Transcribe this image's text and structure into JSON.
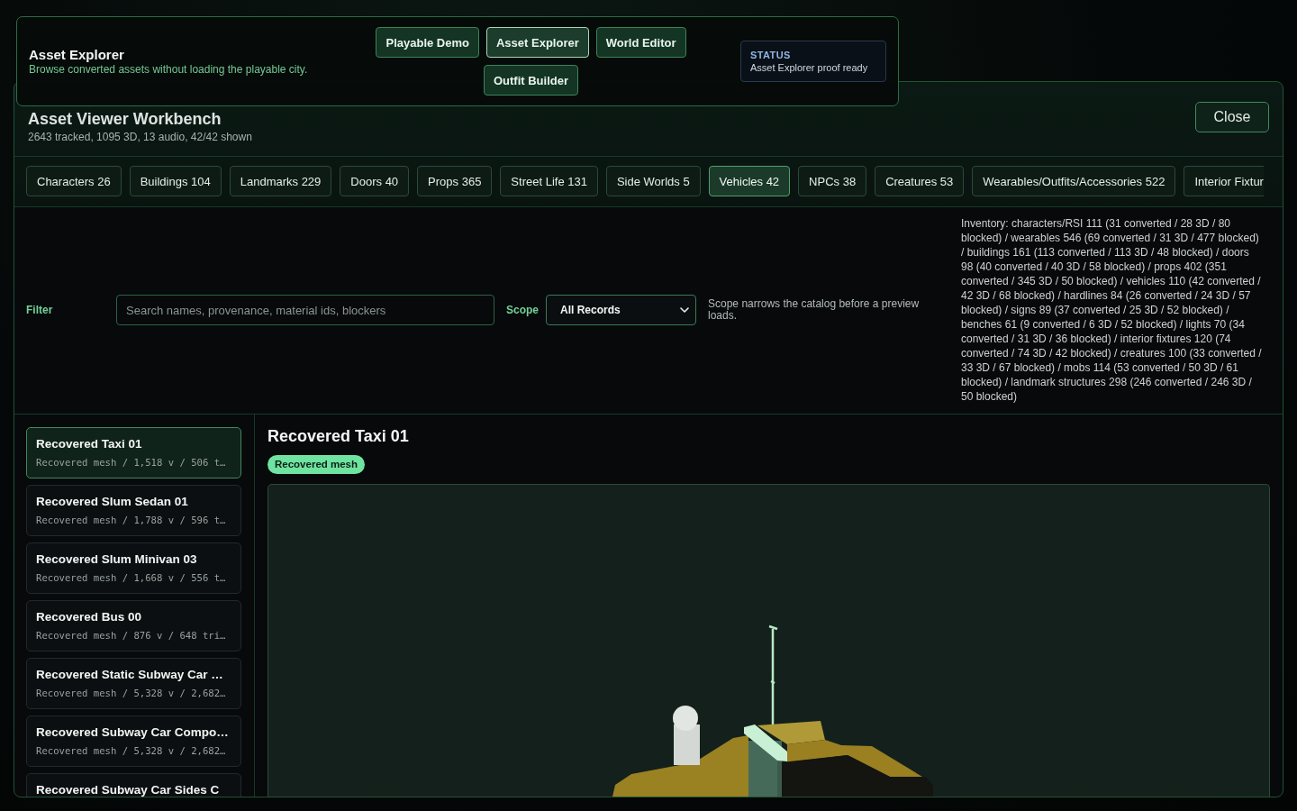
{
  "header": {
    "title": "Asset Explorer",
    "subtitle": "Browse converted assets without loading the playable city.",
    "nav": [
      {
        "label": "Playable Demo",
        "selected": false
      },
      {
        "label": "Asset Explorer",
        "selected": true
      },
      {
        "label": "World Editor",
        "selected": false
      },
      {
        "label": "Outfit Builder",
        "selected": false
      }
    ],
    "status": {
      "label": "STATUS",
      "text": "Asset Explorer proof ready"
    }
  },
  "workbench": {
    "title": "Asset Viewer Workbench",
    "summary": "2643 tracked, 1095 3D, 13 audio, 42/42 shown",
    "close_label": "Close"
  },
  "categories": [
    {
      "label": "Characters 26",
      "selected": false
    },
    {
      "label": "Buildings 104",
      "selected": false
    },
    {
      "label": "Landmarks 229",
      "selected": false
    },
    {
      "label": "Doors 40",
      "selected": false
    },
    {
      "label": "Props 365",
      "selected": false
    },
    {
      "label": "Street Life 131",
      "selected": false
    },
    {
      "label": "Side Worlds 5",
      "selected": false
    },
    {
      "label": "Vehicles 42",
      "selected": true
    },
    {
      "label": "NPCs 38",
      "selected": false
    },
    {
      "label": "Creatures 53",
      "selected": false
    },
    {
      "label": "Wearables/Outfits/Accessories 522",
      "selected": false
    },
    {
      "label": "Interior Fixtur",
      "selected": false
    }
  ],
  "filter": {
    "label": "Filter",
    "placeholder": "Search names, provenance, material ids, blockers",
    "scope_label": "Scope",
    "scope_value": "All Records",
    "scope_hint": "Scope narrows the catalog before a preview loads.",
    "inventory": "Inventory: characters/RSI 111 (31 converted / 28 3D / 80 blocked) / wearables 546 (69 converted / 31 3D / 477 blocked) / buildings 161 (113 converted / 113 3D / 48 blocked) / doors 98 (40 converted / 40 3D / 58 blocked) / props 402 (351 converted / 345 3D / 50 blocked) / vehicles 110 (42 converted / 42 3D / 68 blocked) / hardlines 84 (26 converted / 24 3D / 57 blocked) / signs 89 (37 converted / 25 3D / 52 blocked) / benches 61 (9 converted / 6 3D / 52 blocked) / lights 70 (34 converted / 31 3D / 36 blocked) / interior fixtures 120 (74 converted / 74 3D / 42 blocked) / creatures 100 (33 converted / 33 3D / 67 blocked) / mobs 114 (53 converted / 50 3D / 61 blocked) / landmark structures 298 (246 converted / 246 3D / 50 blocked)"
  },
  "assets": [
    {
      "title": "Recovered Taxi 01",
      "detail": "Recovered mesh / 1,518 v / 506 t…",
      "selected": true
    },
    {
      "title": "Recovered Slum Sedan 01",
      "detail": "Recovered mesh / 1,788 v / 596 t…",
      "selected": false
    },
    {
      "title": "Recovered Slum Minivan 03",
      "detail": "Recovered mesh / 1,668 v / 556 t…",
      "selected": false
    },
    {
      "title": "Recovered Bus 00",
      "detail": "Recovered mesh / 876 v / 648 tri…",
      "selected": false
    },
    {
      "title": "Recovered Static Subway Car …",
      "detail": "Recovered mesh / 5,328 v / 2,682…",
      "selected": false
    },
    {
      "title": "Recovered Subway Car Compo…",
      "detail": "Recovered mesh / 5,328 v / 2,682…",
      "selected": false
    },
    {
      "title": "Recovered Subway Car Sides C",
      "selected": false
    }
  ],
  "preview": {
    "title": "Recovered Taxi 01",
    "badge": "Recovered mesh"
  }
}
